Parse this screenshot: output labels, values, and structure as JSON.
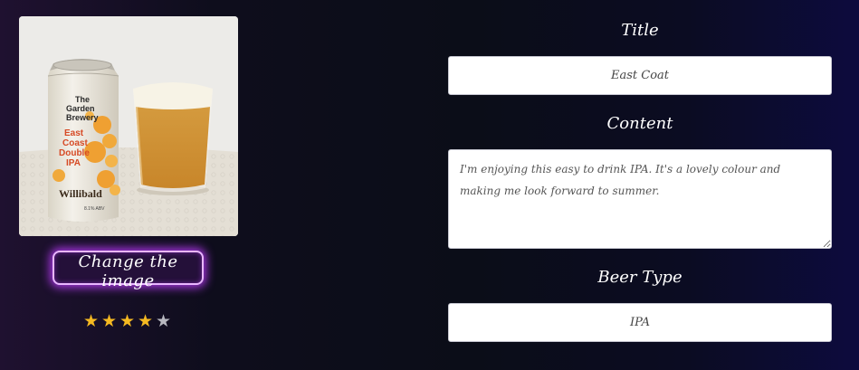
{
  "left_panel": {
    "image_alt": "East Coast Double IPA can with a glass of beer",
    "change_image_label": "Change the image",
    "can_text": {
      "brand_line1": "The",
      "brand_line2": "Garden",
      "brand_line3": "Brewery",
      "beer_line1": "East",
      "beer_line2": "Coast",
      "beer_line3": "Double",
      "beer_line4": "IPA",
      "collab": "Willibald",
      "abv": "8.1% ABV"
    },
    "rating": {
      "value": 4,
      "max": 5
    }
  },
  "form": {
    "title_label": "Title",
    "title_value": "East Coat",
    "content_label": "Content",
    "content_value": "I'm enjoying this easy to drink IPA. It's a lovely colour and making me look forward to summer.",
    "beer_type_label": "Beer Type",
    "beer_type_value": "IPA"
  },
  "colors": {
    "button_glow": "#be3cff",
    "star_on": "#f5b921",
    "star_off": "#b8b8c0"
  }
}
